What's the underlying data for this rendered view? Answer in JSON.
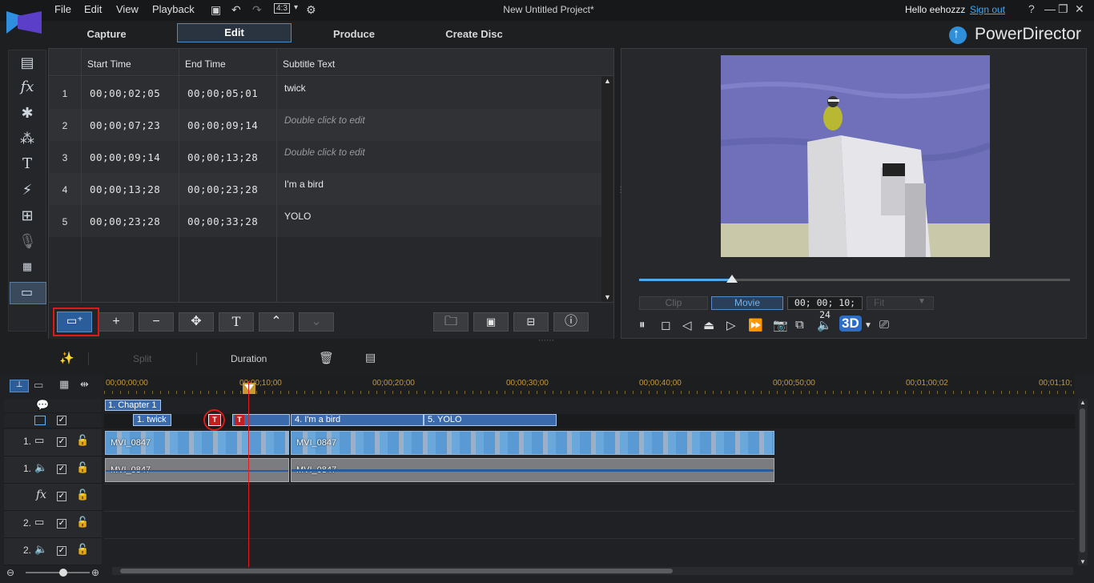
{
  "app": {
    "title": "New Untitled Project*",
    "brand": "PowerDirector",
    "user_greeting": "Hello eehozzz",
    "sign_out": "Sign out",
    "help": "?"
  },
  "menu": [
    "File",
    "Edit",
    "View",
    "Playback"
  ],
  "toolbar": {
    "aspect": "4:3"
  },
  "modes": [
    "Capture",
    "Edit",
    "Produce",
    "Create Disc"
  ],
  "subtitle_table": {
    "headers": [
      "Start Time",
      "End Time",
      "Subtitle Text"
    ],
    "rows": [
      {
        "num": "1",
        "start": "00;00;02;05",
        "end": "00;00;05;01",
        "text": "twick",
        "placeholder": false
      },
      {
        "num": "2",
        "start": "00;00;07;23",
        "end": "00;00;09;14",
        "text": "Double click to edit",
        "placeholder": true
      },
      {
        "num": "3",
        "start": "00;00;09;14",
        "end": "00;00;13;28",
        "text": "Double click to edit",
        "placeholder": true
      },
      {
        "num": "4",
        "start": "00;00;13;28",
        "end": "00;00;23;28",
        "text": "I'm a bird",
        "placeholder": false
      },
      {
        "num": "5",
        "start": "00;00;23;28",
        "end": "00;00;33;28",
        "text": "YOLO",
        "placeholder": false
      }
    ]
  },
  "preview": {
    "clip_label": "Clip",
    "movie_label": "Movie",
    "timecode": "00; 00; 10; 24",
    "fit": "Fit",
    "seek_fraction": 0.216,
    "three_d": "3D"
  },
  "timeline_tools": {
    "split": "Split",
    "duration": "Duration"
  },
  "ruler": [
    "00;00;00;00",
    "00;00;10;00",
    "00;00;20;00",
    "00;00;30;00",
    "00;00;40;00",
    "00;00;50;00",
    "00;01;00;02",
    "00;01;10;"
  ],
  "tracks": {
    "chapter": "1. Chapter 1",
    "subtitles": [
      "1. twick",
      "4. I'm a bird",
      "5. YOLO"
    ],
    "video_label": "1.",
    "audio_label": "1.",
    "video2_label": "2.",
    "audio2_label": "2.",
    "clips": [
      "MVI_0847",
      "MVI_0847"
    ],
    "audio_clips": [
      "MVI_0847",
      "MVI_0847"
    ]
  }
}
